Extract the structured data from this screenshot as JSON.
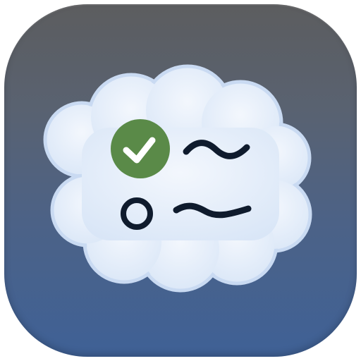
{
  "icon": {
    "name": "cloud-checklist",
    "glyphs": [
      "cloud-icon",
      "checked-circle-icon",
      "empty-circle-icon",
      "wavy-line-icon"
    ]
  },
  "colors": {
    "background_top": "#5c5d5f",
    "background_bottom": "#3f6196",
    "cloud_fill": "#e9f0fa",
    "cloud_outline": "#c9daf2",
    "check_green": "#5a8a48",
    "ink": "#0f1b2d"
  },
  "checklist": {
    "items": [
      {
        "checked": true
      },
      {
        "checked": false
      }
    ]
  }
}
